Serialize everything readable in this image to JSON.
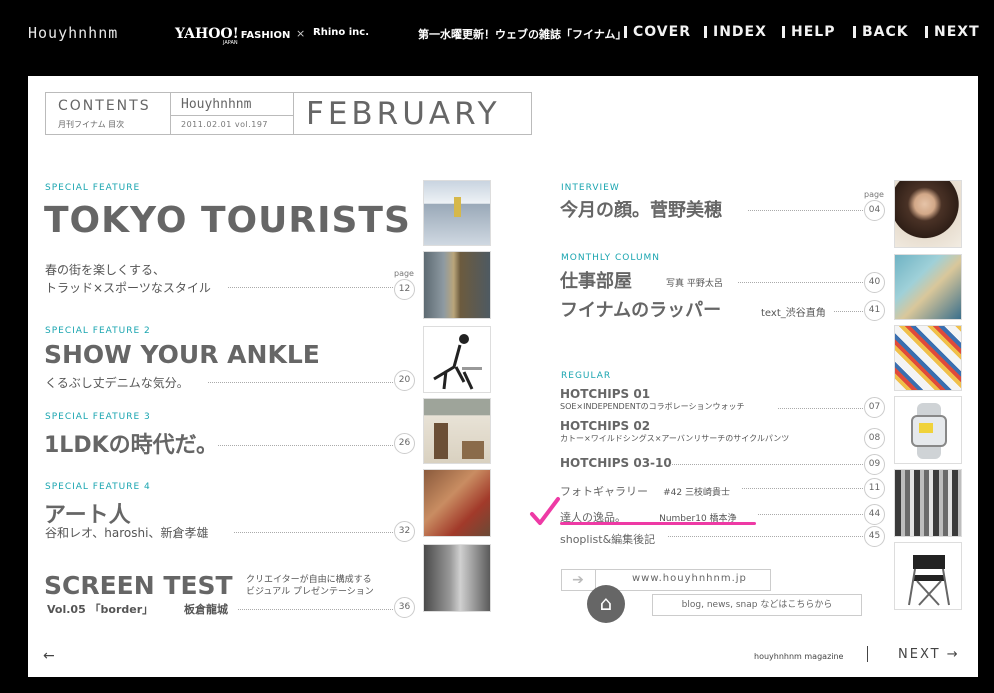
{
  "top": {
    "brand": "Houyhnhnm",
    "partner": "YAHOO!",
    "partner_jp": "JAPAN",
    "partner_fashion": "FASHION",
    "cross": "×",
    "rhino": "Rhino inc.",
    "tagline": "第一水曜更新！ウェブの雑誌「フイナム」",
    "nav": [
      "COVER",
      "INDEX",
      "HELP",
      "BACK",
      "NEXT"
    ]
  },
  "header": {
    "contents": "CONTENTS",
    "contents_sub": "月刊フイナム 目次",
    "brand": "Houyhnhnm",
    "date_vol": "2011.02.01 vol.197",
    "month": "FEBRUARY"
  },
  "left": {
    "page_label": "page",
    "f1": {
      "label": "SPECIAL FEATURE",
      "title": "TOKYO TOURISTS",
      "sub1": "春の街を楽しくする、",
      "sub2": "トラッド×スポーツなスタイル",
      "page": "12"
    },
    "f2": {
      "label": "SPECIAL FEATURE 2",
      "title": "SHOW YOUR ANKLE",
      "sub": "くるぶし丈デニムな気分。",
      "page": "20"
    },
    "f3": {
      "label": "SPECIAL FEATURE 3",
      "title": "1LDKの時代だ。",
      "page": "26"
    },
    "f4": {
      "label": "SPECIAL FEATURE 4",
      "title": "アート人",
      "sub": "谷和レオ、haroshi、新倉孝雄",
      "page": "32"
    },
    "f5": {
      "title": "SCREEN TEST",
      "desc1": "クリエイターが自由に構成する",
      "desc2": "ビジュアル プレゼンテーション",
      "vol": "Vol.05 「border」",
      "name": "板倉龍城",
      "page": "36"
    }
  },
  "right": {
    "page_label": "page",
    "interview": {
      "label": "INTERVIEW",
      "title": "今月の顔。菅野美穂",
      "page": "04"
    },
    "column": {
      "label": "MONTHLY COLUMN",
      "t1": "仕事部屋",
      "t1_sub": "写真 平野太呂",
      "t1_page": "40",
      "t2": "フイナムのラッパー",
      "t2_sub": "text_渋谷直角",
      "t2_page": "41"
    },
    "regular_label": "REGULAR",
    "regular": [
      {
        "main": "HOTCHIPS 01",
        "desc": "SOE×INDEPENDENTのコラボレーションウォッチ",
        "page": "07"
      },
      {
        "main": "HOTCHIPS 02",
        "desc": "カトー×ワイルドシングス×アーバンリサーチのサイクルパンツ",
        "page": "08"
      },
      {
        "main": "HOTCHIPS 03-10",
        "desc": "",
        "page": "09"
      },
      {
        "main": "フォトギャラリー",
        "desc": "#42 三枝崎貴士",
        "page": "11"
      },
      {
        "main": "達人の逸品。",
        "desc": "Number10 橋本浄",
        "page": "44"
      },
      {
        "main": "shoplist&編集後記",
        "desc": "",
        "page": "45"
      }
    ],
    "url": "www.houyhnhnm.jp",
    "blog": "blog, news, snap などはこちらから"
  },
  "footer": {
    "back_arrow": "←",
    "magazine": "houyhnhnm magazine",
    "next": "NEXT →"
  }
}
